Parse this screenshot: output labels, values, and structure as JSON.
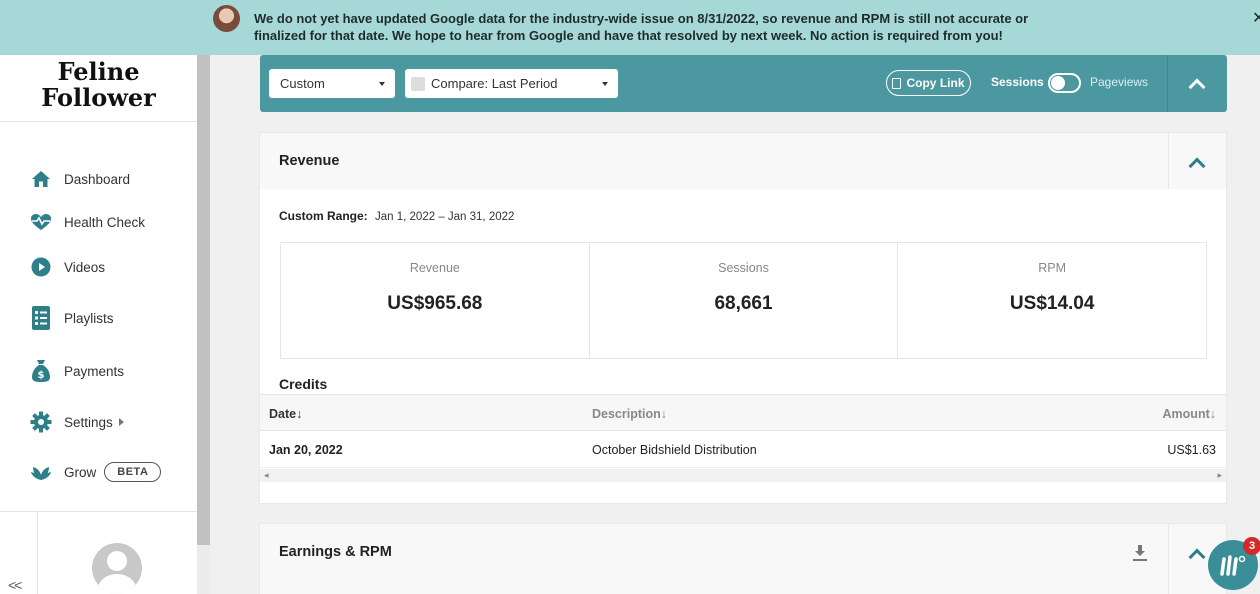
{
  "banner": {
    "text": "We do not yet have updated Google data for the industry-wide issue on 8/31/2022, so revenue and RPM is still not accurate or finalized for that date. We hope to hear from Google and have that resolved by next week.  No action is required from you!",
    "close_icon": "close-icon"
  },
  "sidebar": {
    "logo_line1": "Feline",
    "logo_line2": "Follower",
    "items": [
      {
        "label": "Dashboard",
        "icon": "home-icon"
      },
      {
        "label": "Health Check",
        "icon": "heart-pulse-icon"
      },
      {
        "label": "Videos",
        "icon": "play-icon"
      },
      {
        "label": "Playlists",
        "icon": "list-icon"
      },
      {
        "label": "Payments",
        "icon": "money-bag-icon"
      },
      {
        "label": "Settings",
        "icon": "gear-icon"
      },
      {
        "label": "Grow",
        "icon": "leaf-icon"
      }
    ],
    "grow_badge": "BETA",
    "collapse_label": "<<"
  },
  "toolbar": {
    "date_select": "Custom",
    "compare_select": "Compare: Last Period",
    "copy_link": "Copy Link",
    "toggle_left": "Sessions",
    "toggle_right": "Pageviews"
  },
  "revenue": {
    "title": "Revenue",
    "range_label": "Custom Range:",
    "range_value": "Jan 1, 2022 – Jan 31, 2022",
    "stats": [
      {
        "label": "Revenue",
        "value": "US$965.68"
      },
      {
        "label": "Sessions",
        "value": "68,661"
      },
      {
        "label": "RPM",
        "value": "US$14.04"
      }
    ],
    "credits_title": "Credits",
    "columns": {
      "date": "Date↓",
      "description": "Description↓",
      "amount": "Amount↓"
    },
    "rows": [
      {
        "date": "Jan 20, 2022",
        "description": "October Bidshield Distribution",
        "amount": "US$1.63"
      }
    ]
  },
  "earnings": {
    "title": "Earnings & RPM"
  },
  "chat": {
    "badge": "3"
  },
  "colors": {
    "banner": "#a7d8d8",
    "toolbar": "#4c98a1",
    "accent": "#2e7f8a",
    "badge": "#d42a2a"
  }
}
